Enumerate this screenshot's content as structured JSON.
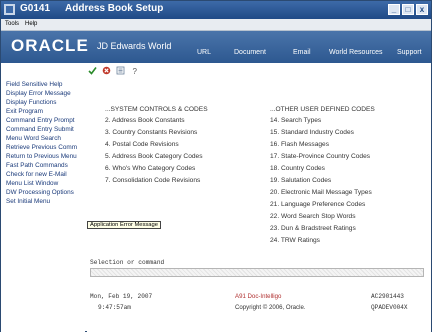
{
  "window": {
    "code": "G0141",
    "title": "Address Book Setup",
    "controls": [
      "_",
      "□",
      "x"
    ]
  },
  "menubar": {
    "tools": "Tools",
    "help": "Help"
  },
  "banner": {
    "oracle": "ORACLE",
    "product": "JD Edwards World",
    "nav": [
      "URL",
      "Document",
      "Email",
      "World Resources",
      "Support"
    ]
  },
  "sidebar": {
    "items": [
      "Field Sensitive Help",
      "Display Error Message",
      "Display Functions",
      "Exit Program",
      "Command Entry Prompt",
      "Command Entry Submit",
      "Menu Word Search",
      "Retrieve Previous Comm",
      "Return to Previous Menu",
      "Fast Path Commands",
      "Check for new E-Mail",
      "Menu List Window",
      "DW Processing Options",
      "Set Initial Menu"
    ]
  },
  "menu": {
    "left_header": "...SYSTEM CONTROLS & CODES",
    "left": [
      "2. Address Book Constants",
      "3. Country Constants Revisions",
      "4. Postal Code Revisions",
      "5. Address Book Category Codes",
      "6. Who's Who Category Codes",
      "7. Consolidation Code Revisions"
    ],
    "right_header": "...OTHER USER DEFINED CODES",
    "right": [
      "14. Search Types",
      "15. Standard Industry Codes",
      "16. Flash Messages",
      "17. State-Province Country Codes",
      "18. Country Codes",
      "19. Salutation Codes",
      "20. Electronic Mail Message Types",
      "21. Language Preference Codes",
      "22. Word Search Stop Words",
      "23. Dun & Bradstreet Ratings",
      "24. TRW Ratings"
    ]
  },
  "command": {
    "label": "Selection or command"
  },
  "status": {
    "date": "Mon, Feb 19, 2007",
    "time": "9:47:57am",
    "company": "A91 Doc-Intelligo",
    "copyright": "Copyright © 2006, Oracle.",
    "machine": "AC2901443",
    "program": "QPADEV004X"
  },
  "tooltip": "Application Error Message"
}
